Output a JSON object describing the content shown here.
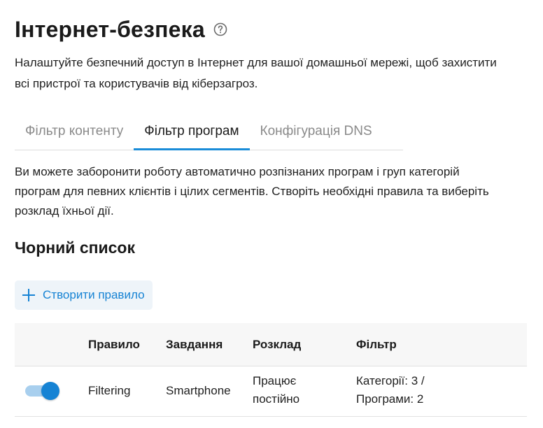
{
  "header": {
    "title": "Інтернет-безпека",
    "help_icon": "question-circle-icon"
  },
  "intro": {
    "line1": "Налаштуйте безпечний доступ в Інтернет для вашої домашньої мережі, щоб захистити",
    "line2": "всі пристрої та користувачів від кіберзагроз."
  },
  "tabs": [
    {
      "label": "Фільтр контенту",
      "active": false
    },
    {
      "label": "Фільтр програм",
      "active": true
    },
    {
      "label": "Конфігурація DNS",
      "active": false
    }
  ],
  "app_filter": {
    "description_line1": "Ви можете заборонити роботу автоматично розпізнаних програм і груп категорій",
    "description_line2": "програм для певних клієнтів і цілих сегментів. Створіть необхідні правила та виберіть",
    "description_line3": "розклад їхньої дії.",
    "section_title": "Чорний список",
    "create_button_label": "Створити правило",
    "create_button_icon": "plus-icon",
    "table": {
      "headers": {
        "rule": "Правило",
        "task": "Завдання",
        "schedule": "Розклад",
        "filter": "Фільтр"
      },
      "rows": [
        {
          "enabled": true,
          "rule": "Filtering",
          "task": "Smartphone",
          "schedule_line1": "Працює",
          "schedule_line2": "постійно",
          "filter_line1": "Категорії: 3 /",
          "filter_line2": "Програми: 2"
        }
      ]
    }
  },
  "colors": {
    "accent": "#1683d4",
    "tab_underline": "#1a8cd8",
    "toggle_track": "#a8cfee",
    "button_bg": "#eef4f9",
    "header_bg": "#f7f7f7"
  }
}
